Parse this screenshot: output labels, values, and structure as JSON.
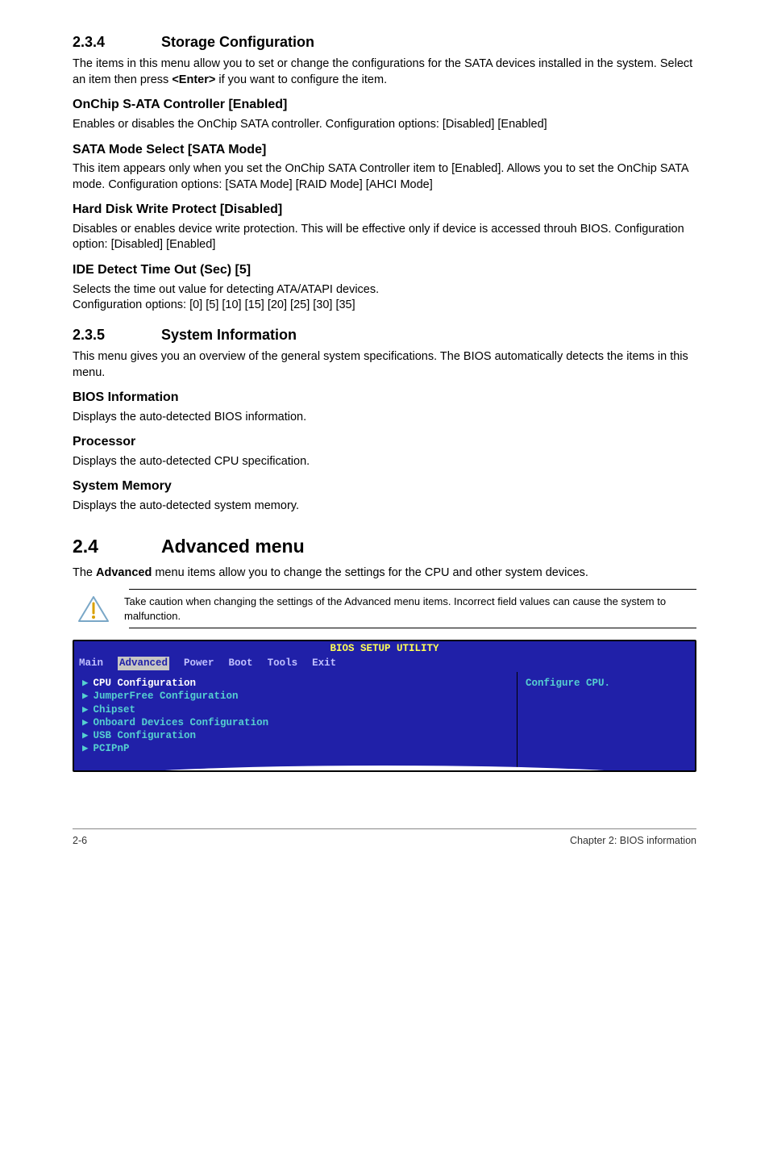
{
  "s234": {
    "num": "2.3.4",
    "title": "Storage Configuration",
    "intro_a": "The items in this menu allow you to set or change the configurations for the SATA devices installed in the system. Select an item then press ",
    "intro_b": "<Enter>",
    "intro_c": " if you want to configure the item.",
    "onchip_h": "OnChip S-ATA Controller [Enabled]",
    "onchip_p": "Enables or disables the OnChip SATA controller. Configuration options: [Disabled] [Enabled]",
    "sata_h": "SATA Mode Select [SATA Mode]",
    "sata_p": "This item appears only when you set the OnChip SATA Controller item to [Enabled]. Allows you to set the OnChip SATA mode. Configuration options: [SATA Mode] [RAID Mode] [AHCI Mode]",
    "hd_h": "Hard Disk Write Protect [Disabled]",
    "hd_p": "Disables or enables device write protection. This will be effective only if device is accessed throuh BIOS. Configuration option: [Disabled] [Enabled]",
    "ide_h": "IDE Detect Time Out (Sec) [5]",
    "ide_p1": "Selects the time out value for detecting ATA/ATAPI devices.",
    "ide_p2": "Configuration options: [0] [5] [10] [15] [20] [25] [30] [35]"
  },
  "s235": {
    "num": "2.3.5",
    "title": "System Information",
    "intro": "This menu gives you an overview of the general system specifications. The BIOS automatically detects the items in this menu.",
    "bios_h": "BIOS Information",
    "bios_p": "Displays the auto-detected BIOS information.",
    "proc_h": "Processor",
    "proc_p": "Displays the auto-detected CPU specification.",
    "mem_h": "System Memory",
    "mem_p": "Displays the auto-detected system memory."
  },
  "s24": {
    "num": "2.4",
    "title": "Advanced menu",
    "intro_a": "The ",
    "intro_b": "Advanced",
    "intro_c": " menu items allow you to change the settings for the CPU and other system devices.",
    "note": "Take caution when changing the settings of the Advanced menu items. Incorrect field values can cause the system to malfunction."
  },
  "bios": {
    "title": "BIOS SETUP UTILITY",
    "tabs": {
      "main": "Main",
      "advanced": "Advanced",
      "power": "Power",
      "boot": "Boot",
      "tools": "Tools",
      "exit": "Exit"
    },
    "items": {
      "cpu": "CPU Configuration",
      "jumper": "JumperFree Configuration",
      "chipset": "Chipset",
      "onboard": "Onboard Devices Configuration",
      "usb": "USB Configuration",
      "pcipnp": "PCIPnP"
    },
    "help": "Configure CPU."
  },
  "footer": {
    "page": "2-6",
    "chapter": "Chapter 2: BIOS information"
  }
}
